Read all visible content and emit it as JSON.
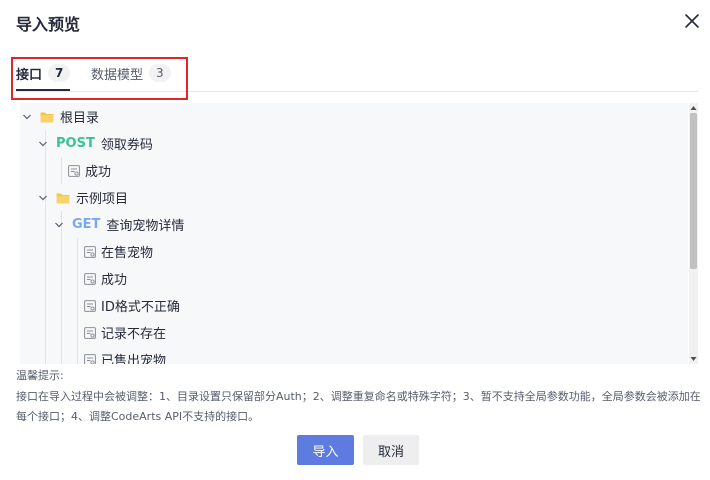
{
  "dialog": {
    "title": "导入预览",
    "close_icon": "close-icon"
  },
  "tabs": [
    {
      "label": "接口",
      "count": "7",
      "active": true
    },
    {
      "label": "数据模型",
      "count": "3",
      "active": false
    }
  ],
  "tree": {
    "root": {
      "label": "根目录",
      "icon": "folder-icon",
      "expanded": true
    },
    "post_api": {
      "method": "POST",
      "label": "领取券码",
      "expanded": true
    },
    "post_case_success": {
      "label": "成功",
      "icon": "case-icon"
    },
    "folder_example": {
      "label": "示例项目",
      "icon": "folder-icon",
      "expanded": true
    },
    "get_api": {
      "method": "GET",
      "label": "查询宠物详情",
      "expanded": true
    },
    "get_cases": [
      {
        "label": "在售宠物"
      },
      {
        "label": "成功"
      },
      {
        "label": "ID格式不正确"
      },
      {
        "label": "记录不存在"
      },
      {
        "label": "已售出宠物"
      }
    ]
  },
  "tips": {
    "title": "温馨提示:",
    "body": "接口在导入过程中会被调整：1、目录设置只保留部分Auth；2、调整重复命名或特殊字符；3、暂不支持全局参数功能，全局参数会被添加在每个接口；4、调整CodeArts API不支持的接口。"
  },
  "footer": {
    "import_label": "导入",
    "cancel_label": "取消"
  },
  "colors": {
    "primary": "#5e7ce0",
    "post_method": "#3ac295",
    "get_method": "#7aa7f5",
    "folder": "#f6c344",
    "highlight_border": "#e0262b"
  }
}
